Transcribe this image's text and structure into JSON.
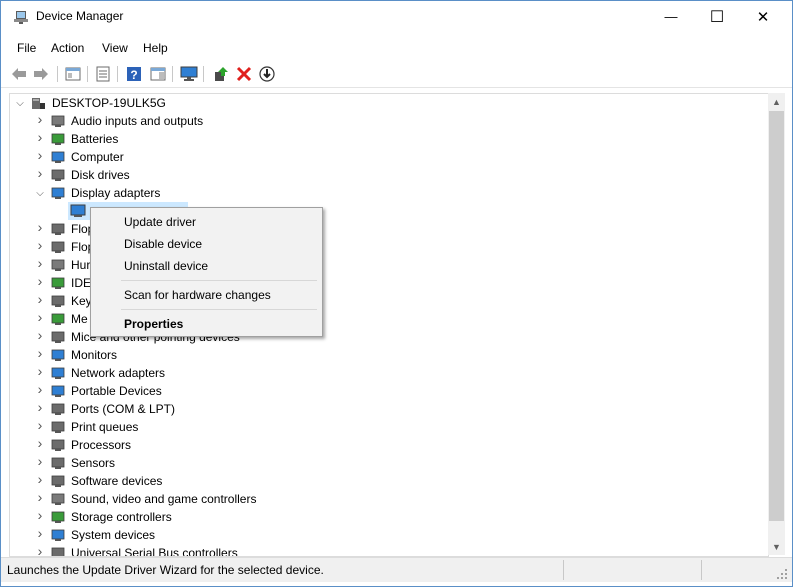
{
  "window": {
    "title": "Device Manager"
  },
  "controls": {
    "minimize": "—",
    "maximize": "☐",
    "close": "✕"
  },
  "menu": [
    "File",
    "Action",
    "View",
    "Help"
  ],
  "toolbar_icons": [
    "back-arrow-icon",
    "forward-arrow-icon",
    "show-hide-tree-icon",
    "properties-icon",
    "help-icon",
    "action-pane-icon",
    "monitor-icon",
    "update-driver-icon",
    "uninstall-device-icon",
    "download-icon"
  ],
  "tree": {
    "root": "DESKTOP-19ULK5G",
    "items": [
      {
        "label": "Audio inputs and outputs",
        "icon": "speaker-icon",
        "expanded": false
      },
      {
        "label": "Batteries",
        "icon": "battery-icon",
        "expanded": false
      },
      {
        "label": "Computer",
        "icon": "computer-icon",
        "expanded": false
      },
      {
        "label": "Disk drives",
        "icon": "disk-icon",
        "expanded": false
      },
      {
        "label": "Display adapters",
        "icon": "display-adapter-icon",
        "expanded": true
      },
      {
        "label": "Flop",
        "icon": "floppy-icon",
        "expanded": false
      },
      {
        "label": "Flop",
        "icon": "floppy-icon",
        "expanded": false
      },
      {
        "label": "Hur",
        "icon": "hid-icon",
        "expanded": false
      },
      {
        "label": "IDE",
        "icon": "ide-icon",
        "expanded": false
      },
      {
        "label": "Key",
        "icon": "keyboard-icon",
        "expanded": false
      },
      {
        "label": "Me",
        "icon": "memory-icon",
        "expanded": false
      },
      {
        "label": "Mice and other pointing devices",
        "icon": "mouse-icon",
        "expanded": false
      },
      {
        "label": "Monitors",
        "icon": "monitor-icon",
        "expanded": false
      },
      {
        "label": "Network adapters",
        "icon": "network-icon",
        "expanded": false
      },
      {
        "label": "Portable Devices",
        "icon": "portable-device-icon",
        "expanded": false
      },
      {
        "label": "Ports (COM & LPT)",
        "icon": "port-icon",
        "expanded": false
      },
      {
        "label": "Print queues",
        "icon": "printer-icon",
        "expanded": false
      },
      {
        "label": "Processors",
        "icon": "processor-icon",
        "expanded": false
      },
      {
        "label": "Sensors",
        "icon": "sensor-icon",
        "expanded": false
      },
      {
        "label": "Software devices",
        "icon": "software-device-icon",
        "expanded": false
      },
      {
        "label": "Sound, video and game controllers",
        "icon": "speaker-icon",
        "expanded": false
      },
      {
        "label": "Storage controllers",
        "icon": "storage-icon",
        "expanded": false
      },
      {
        "label": "System devices",
        "icon": "system-device-icon",
        "expanded": false
      },
      {
        "label": "Universal Serial Bus controllers",
        "icon": "usb-icon",
        "expanded": false
      }
    ]
  },
  "context_menu": {
    "items": [
      "Update driver",
      "Disable device",
      "Uninstall device",
      "Scan for hardware changes",
      "Properties"
    ]
  },
  "status": {
    "text": "Launches the Update Driver Wizard for the selected device."
  },
  "colors": {
    "selection": "#cce8ff",
    "menu_bg": "#f2f2f2",
    "window_border": "#5a8fc7"
  }
}
